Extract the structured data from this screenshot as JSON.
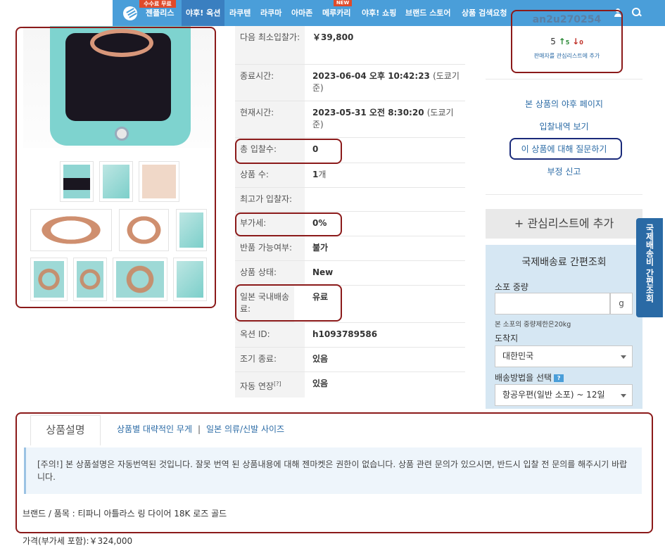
{
  "nav": {
    "free_badge": "수수료 무료",
    "items": [
      "젠플리스",
      "야후! 옥션",
      "라쿠텐",
      "라쿠마",
      "아마존",
      "메루카리",
      "야후! 쇼핑",
      "브랜드 스토어",
      "상품 검색요청"
    ],
    "new_badge": "NEW"
  },
  "info": {
    "rows": [
      {
        "label": "다음 최소입찰가:",
        "value": "￥39,800",
        "note": ""
      },
      {
        "label": "종료시간:",
        "value": "2023-06-04 오후 10:42:23",
        "note": "(도쿄기준)"
      },
      {
        "label": "현재시간:",
        "value": "2023-05-31 오전 8:30:20",
        "note": "(도쿄기준)"
      },
      {
        "label": "총 입찰수:",
        "value": "0",
        "note": ""
      },
      {
        "label": "상품 수:",
        "value": "1",
        "note": "개"
      },
      {
        "label": "최고가 입찰자:",
        "value": "",
        "note": ""
      },
      {
        "label": "부가세:",
        "value": "0%",
        "note": ""
      },
      {
        "label": "반품 가능여부:",
        "value": "불가",
        "note": ""
      },
      {
        "label": "상품 상태:",
        "value": "New",
        "note": ""
      },
      {
        "label": "일본 국내배송료:",
        "value": "유료",
        "note": ""
      },
      {
        "label": "옥션 ID:",
        "value": "h1093789586",
        "note": ""
      },
      {
        "label": "조기 종료:",
        "value": "있음",
        "note": ""
      },
      {
        "label": "자동 연장",
        "value": "있음",
        "note": "[?]"
      }
    ]
  },
  "seller": {
    "id": "an2u270254",
    "rating_total": "5",
    "rating_up": "5",
    "rating_down": "0",
    "watch_link": "판매자를 관심리스트에 추가"
  },
  "side_links": {
    "yahoo_page": "본 상품의 야후 페이지",
    "bid_history": "입찰내역 보기",
    "ask_question": "이 상품에 대해 질문하기",
    "report": "부정 신고"
  },
  "watchlist_button": "+ 관심리스트에 추가",
  "shipping": {
    "title": "국제배송료 간편조회",
    "weight_label": "소포 중량",
    "unit": "g",
    "weight_note": "본 소포의 중량제한은20kg",
    "dest_label": "도착지",
    "dest_value": "대한민국",
    "method_label": "배송방법을 선택",
    "method_help": "?",
    "method_value": "항공우편(일반 소포) ~ 12일",
    "side_tab": "국제배송비 간편조회"
  },
  "description": {
    "tab": "상품설명",
    "link_weight": "상품별 대략적인 무게",
    "separator": "|",
    "link_size": "일본 의류/신발 사이즈",
    "notice": "[주의!] 본 상품설명은 자동번역된 것입니다. 잘못 번역 된 상품내용에 대해 젠마켓은 권한이 없습니다. 상품 관련 문의가 있으시면, 반드시 입찰 전 문의를 해주시기 바랍니다.",
    "brand_line": "브랜드 / 품목 : 티파니 아틀라스 링 다이어 18K 로즈 골드",
    "price_line": "가격(부가세 포함):￥324,000"
  },
  "colors": {
    "nav_bg": "#4a9ed9",
    "nav_active": "#3a7fc0",
    "highlight_red": "#8b1a1a",
    "highlight_navy": "#1a2a7a",
    "link": "#2a6aa5",
    "shipping_panel": "#d6e7f3"
  }
}
